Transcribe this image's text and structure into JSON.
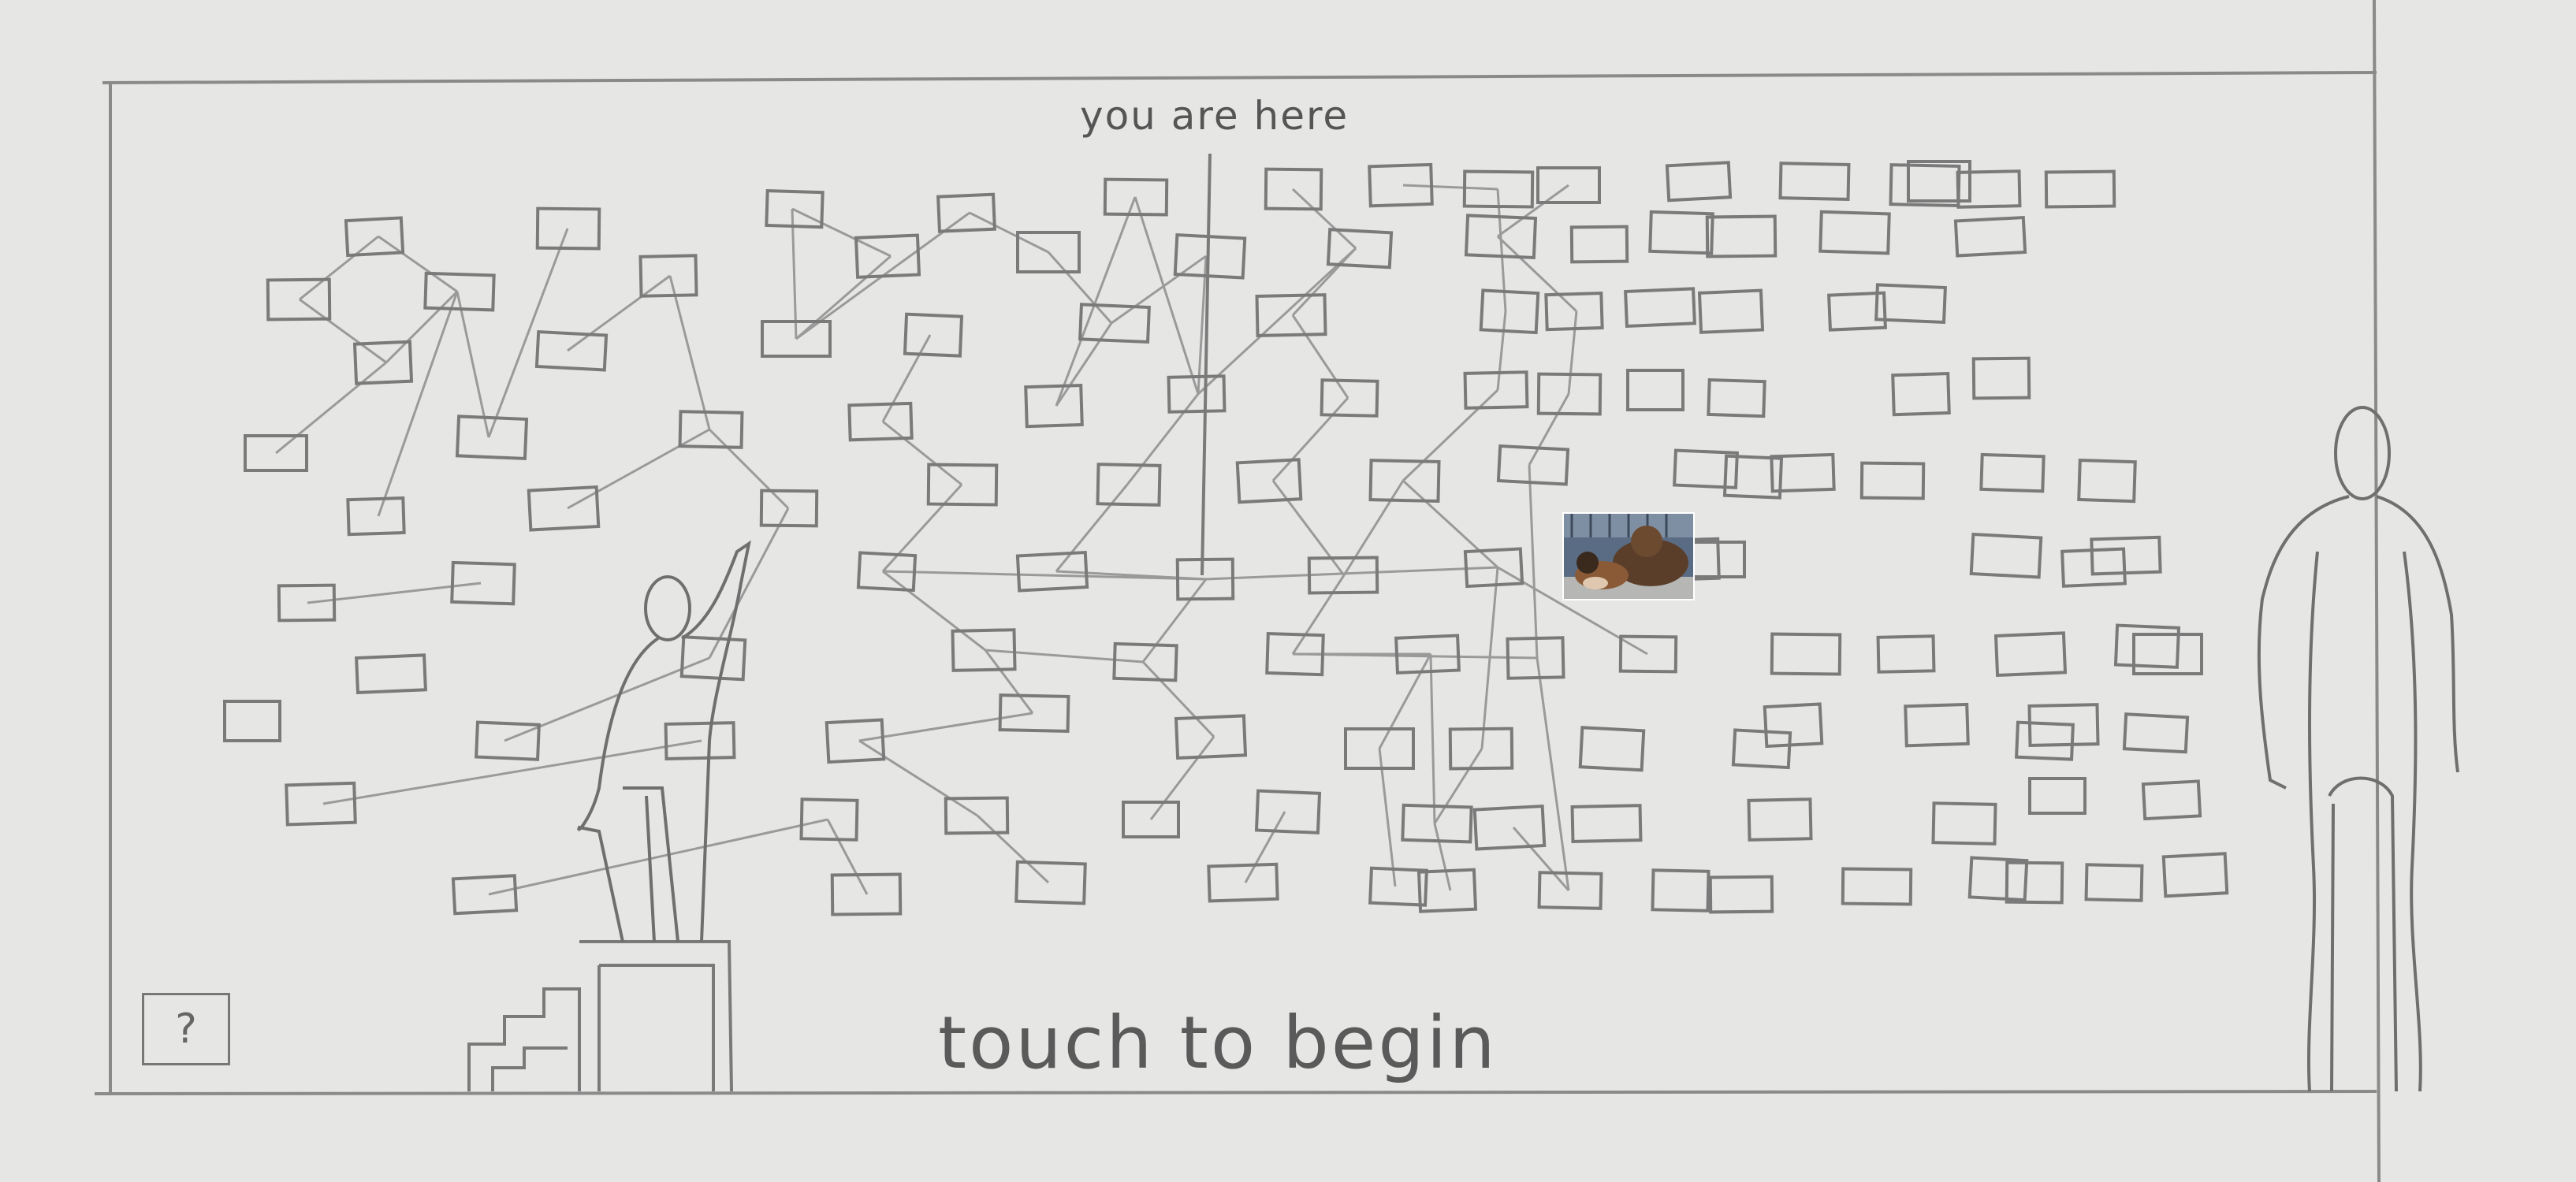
{
  "labels": {
    "you_are_here": "you are here",
    "touch_to_begin": "touch to begin",
    "help": "?"
  },
  "colors": {
    "paper": "#e6e6e4",
    "pencil": "#808080"
  }
}
